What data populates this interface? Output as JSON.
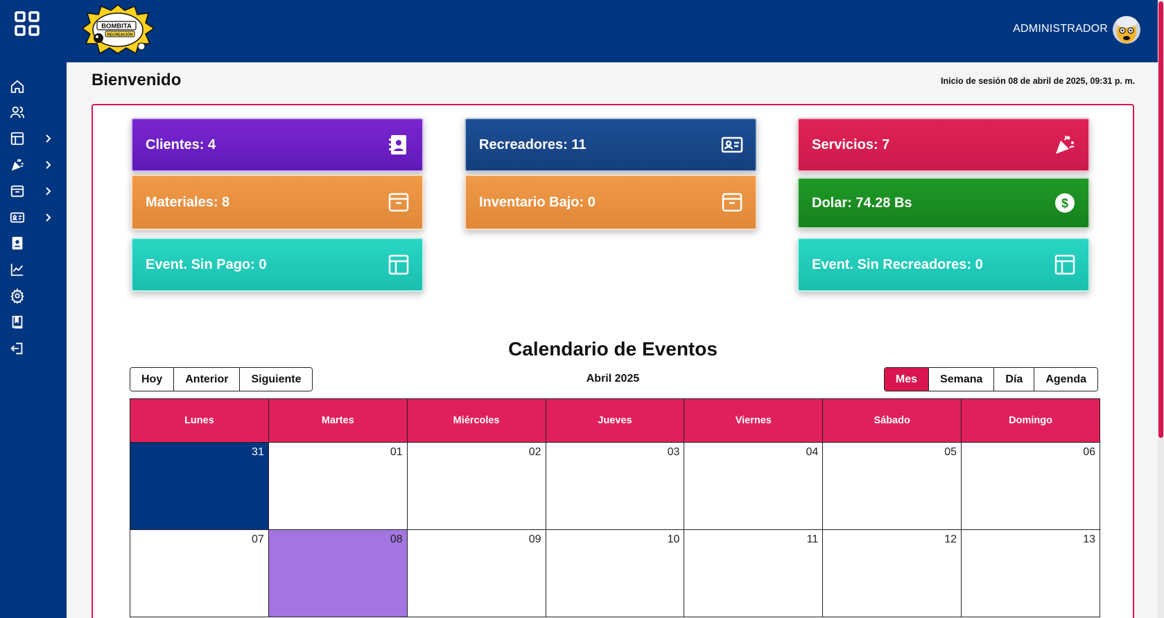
{
  "header": {
    "brand_logo": "Bombita Recreación",
    "admin_name": "ADMINISTRADOR"
  },
  "sidebar": {
    "items": [
      {
        "icon": "home-icon",
        "has_submenu": false
      },
      {
        "icon": "users-icon",
        "has_submenu": false
      },
      {
        "icon": "layout-icon",
        "has_submenu": true
      },
      {
        "icon": "party-popper-icon",
        "has_submenu": true
      },
      {
        "icon": "archive-box-icon",
        "has_submenu": true
      },
      {
        "icon": "id-card-icon",
        "has_submenu": true
      },
      {
        "icon": "contact-book-icon",
        "has_submenu": false
      },
      {
        "icon": "chart-line-icon",
        "has_submenu": false
      },
      {
        "icon": "gear-icon",
        "has_submenu": false
      },
      {
        "icon": "book-icon",
        "has_submenu": false
      },
      {
        "icon": "logout-icon",
        "has_submenu": false
      }
    ]
  },
  "page": {
    "title": "Bienvenido",
    "login_info": "Inicio de sesión 08 de abril de 2025, 09:31 p. m."
  },
  "cards": {
    "clientes": "Clientes: 4",
    "recreadores": "Recreadores: 11",
    "servicios": "Servicios: 7",
    "materiales": "Materiales: 8",
    "inventario_bajo": "Inventario Bajo: 0",
    "dolar": "Dolar: 74.28 Bs",
    "event_sin_pago": "Event. Sin Pago: 0",
    "event_sin_recreadores": "Event. Sin Recreadores: 0"
  },
  "colors": {
    "primary": "#003580",
    "accent": "#d9154f",
    "purple": "#6a1fc4",
    "orange": "#ea913f",
    "green": "#1b8e22",
    "teal": "#22cbb8",
    "today": "#a375e0"
  },
  "calendar": {
    "title": "Calendario de Eventos",
    "nav": {
      "today": "Hoy",
      "prev": "Anterior",
      "next": "Siguiente"
    },
    "month_label": "Abril 2025",
    "views": {
      "month": "Mes",
      "week": "Semana",
      "day": "Día",
      "agenda": "Agenda"
    },
    "active_view": "Mes",
    "weekdays": [
      "Lunes",
      "Martes",
      "Miércoles",
      "Jueves",
      "Viernes",
      "Sábado",
      "Domingo"
    ],
    "weeks": [
      [
        "31",
        "01",
        "02",
        "03",
        "04",
        "05",
        "06"
      ],
      [
        "07",
        "08",
        "09",
        "10",
        "11",
        "12",
        "13"
      ]
    ],
    "today": "08"
  }
}
